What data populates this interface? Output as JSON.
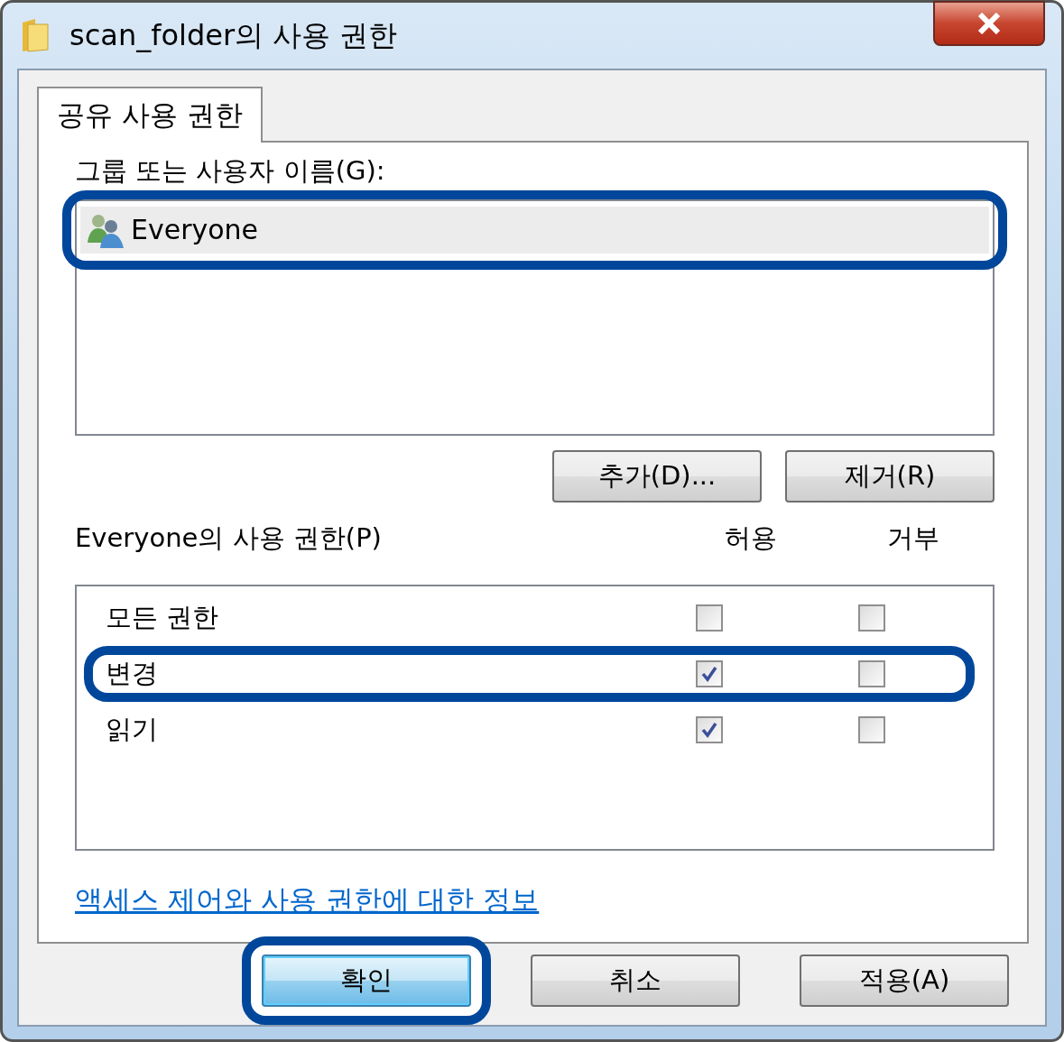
{
  "window": {
    "title": "scan_folder의 사용 권한"
  },
  "tabs": [
    {
      "label": "공유 사용 권한",
      "selected": true
    }
  ],
  "group_label": "그룹 또는 사용자 이름(G):",
  "users": [
    {
      "name": "Everyone",
      "selected": true,
      "highlighted": true
    }
  ],
  "user_buttons": [
    "추가(D)...",
    "제거(R)"
  ],
  "permissions": {
    "label": "Everyone의 사용 권한(P)",
    "columns": [
      "허용",
      "거부"
    ],
    "rows": [
      {
        "name": "모든 권한",
        "allow": false,
        "deny": false,
        "highlighted": false
      },
      {
        "name": "변경",
        "allow": true,
        "deny": false,
        "highlighted": true
      },
      {
        "name": "읽기",
        "allow": true,
        "deny": false,
        "highlighted": false
      }
    ]
  },
  "link": "액세스 제어와 사용 권한에 대한 정보",
  "buttons": [
    {
      "label": "확인",
      "default": true,
      "highlighted": true
    },
    {
      "label": "취소",
      "default": false,
      "highlighted": false
    },
    {
      "label": "적용(A)",
      "default": false,
      "highlighted": false
    }
  ]
}
